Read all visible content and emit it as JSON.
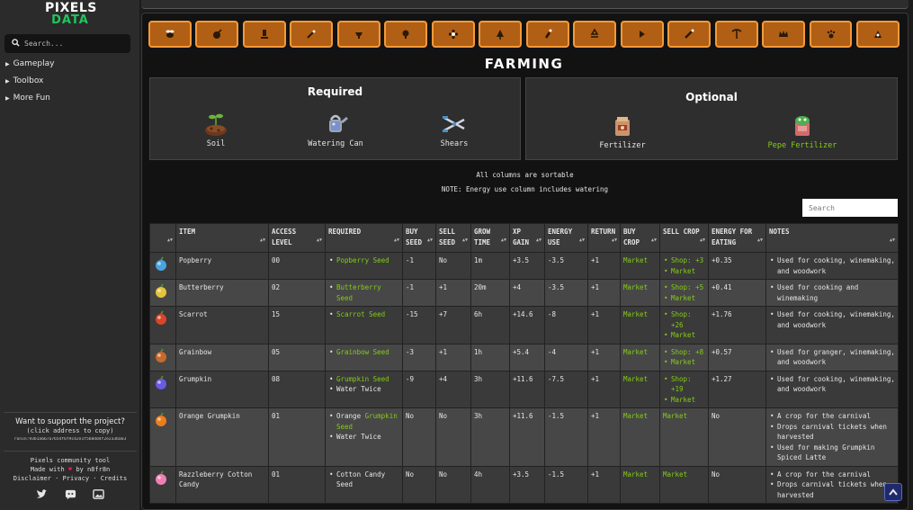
{
  "sidebar": {
    "logo_line1": "PIXELS",
    "logo_line2": "DATA",
    "search_placeholder": "Search...",
    "nav": [
      "Gameplay",
      "Toolbox",
      "More Fun"
    ],
    "support_title": "Want to support the project?",
    "support_sub": "(click address to copy)",
    "support_address": "ronin:93b1a667a7654f6f9c42e1f5b8dd4f2e233ba63",
    "credits_line1": "Pixels community tool",
    "credits_made": "Made with",
    "credits_by": "by n8fr8n",
    "credits_links": [
      "Disclaimer",
      "Privacy",
      "Credits"
    ],
    "social_icons": [
      "twitter-icon",
      "discord-icon",
      "image-icon"
    ]
  },
  "skills": [
    "bee",
    "animal-care",
    "cooking",
    "forestry",
    "mining-cart",
    "woodwork",
    "flower",
    "tree",
    "crafting",
    "recycle",
    "stone",
    "metalwork",
    "pickaxe",
    "crown",
    "paw",
    "exploration"
  ],
  "page": {
    "title": "FARMING",
    "required_title": "Required",
    "optional_title": "Optional",
    "required_tools": [
      "Soil",
      "Watering Can",
      "Shears"
    ],
    "optional_tools": [
      "Fertilizer",
      "Pepe Fertilizer"
    ],
    "note1": "All columns are sortable",
    "note2": "NOTE: Energy use column includes watering",
    "table_search_placeholder": "Search"
  },
  "table": {
    "headers": [
      "",
      "ITEM",
      "ACCESS LEVEL",
      "REQUIRED",
      "BUY SEED",
      "SELL SEED",
      "GROW TIME",
      "XP GAIN",
      "ENERGY USE",
      "RETURN",
      "BUY CROP",
      "SELL CROP",
      "ENERGY FOR EATING",
      "NOTES"
    ],
    "rows": [
      {
        "icon": "popberry-icon",
        "color": "#4aa3df",
        "item": "Popberry",
        "level": "00",
        "required": [
          {
            "t": "Popberry Seed",
            "g": true
          }
        ],
        "buy_seed": "-1",
        "sell_seed": "No",
        "grow": "1m",
        "xp": "+3.5",
        "energy": "-3.5",
        "ret": "+1",
        "buy_crop": "Market",
        "sell_crop": [
          {
            "pre": "Shop: +3"
          },
          {
            "g": "Market"
          }
        ],
        "eat": "+0.35",
        "notes": [
          "Used for cooking, winemaking, and woodwork"
        ]
      },
      {
        "icon": "butterberry-icon",
        "color": "#e4c43a",
        "item": "Butterberry",
        "level": "02",
        "required": [
          {
            "t": "Butterberry Seed",
            "g": true
          }
        ],
        "buy_seed": "-1",
        "sell_seed": "+1",
        "grow": "20m",
        "xp": "+4",
        "energy": "-3.5",
        "ret": "+1",
        "buy_crop": "Market",
        "sell_crop": [
          {
            "pre": "Shop: +5"
          },
          {
            "g": "Market"
          }
        ],
        "eat": "+0.41",
        "notes": [
          "Used for cooking and winemaking"
        ]
      },
      {
        "icon": "scarrot-icon",
        "color": "#d9452b",
        "item": "Scarrot",
        "level": "15",
        "required": [
          {
            "t": "Scarrot Seed",
            "g": true
          }
        ],
        "buy_seed": "-15",
        "sell_seed": "+7",
        "grow": "6h",
        "xp": "+14.6",
        "energy": "-8",
        "ret": "+1",
        "buy_crop": "Market",
        "sell_crop": [
          {
            "pre": "Shop: +26"
          },
          {
            "g": "Market"
          }
        ],
        "eat": "+1.76",
        "notes": [
          "Used for cooking, winemaking, and woodwork"
        ]
      },
      {
        "icon": "grainbow-icon",
        "color": "#c76a2c",
        "item": "Grainbow",
        "level": "05",
        "required": [
          {
            "t": "Grainbow Seed",
            "g": true
          }
        ],
        "buy_seed": "-3",
        "sell_seed": "+1",
        "grow": "1h",
        "xp": "+5.4",
        "energy": "-4",
        "ret": "+1",
        "buy_crop": "Market",
        "sell_crop": [
          {
            "pre": "Shop: +8"
          },
          {
            "g": "Market"
          }
        ],
        "eat": "+0.57",
        "notes": [
          "Used for granger, winemaking, and woodwork"
        ]
      },
      {
        "icon": "grumpkin-icon",
        "color": "#6a5be0",
        "item": "Grumpkin",
        "level": "08",
        "required": [
          {
            "t": "Grumpkin Seed",
            "g": true
          },
          {
            "t": "Water Twice",
            "g": false
          }
        ],
        "buy_seed": "-9",
        "sell_seed": "+4",
        "grow": "3h",
        "xp": "+11.6",
        "energy": "-7.5",
        "ret": "+1",
        "buy_crop": "Market",
        "sell_crop": [
          {
            "pre": "Shop: +19"
          },
          {
            "g": "Market"
          }
        ],
        "eat": "+1.27",
        "notes": [
          "Used for cooking, winemaking, and woodwork"
        ]
      },
      {
        "icon": "orange-grumpkin-icon",
        "color": "#ee7d1a",
        "item": "Orange Grumpkin",
        "level": "01",
        "required": [
          {
            "t": "Orange ",
            "g": false,
            "t2": "Grumpkin Seed"
          },
          {
            "t": "Water Twice",
            "g": false
          }
        ],
        "buy_seed": "No",
        "sell_seed": "No",
        "grow": "3h",
        "xp": "+11.6",
        "energy": "-1.5",
        "ret": "+1",
        "buy_crop": "Market",
        "sell_crop": [
          {
            "g": "Market"
          }
        ],
        "eat": "No",
        "notes": [
          "A crop for the carnival",
          "Drops carnival tickets when harvested",
          "Used for making Grumpkin Spiced Latte"
        ]
      },
      {
        "icon": "cotton-candy-icon",
        "color": "#ef7fb4",
        "item": "Razzleberry Cotton Candy",
        "level": "01",
        "required": [
          {
            "t": "Cotton Candy Seed",
            "g": false
          }
        ],
        "buy_seed": "No",
        "sell_seed": "No",
        "grow": "4h",
        "xp": "+3.5",
        "energy": "-1.5",
        "ret": "+1",
        "buy_crop": "Market",
        "sell_crop": [
          {
            "g": "Market"
          }
        ],
        "eat": "No",
        "notes": [
          "A crop for the carnival",
          "Drops carnival tickets when harvested"
        ]
      }
    ]
  }
}
